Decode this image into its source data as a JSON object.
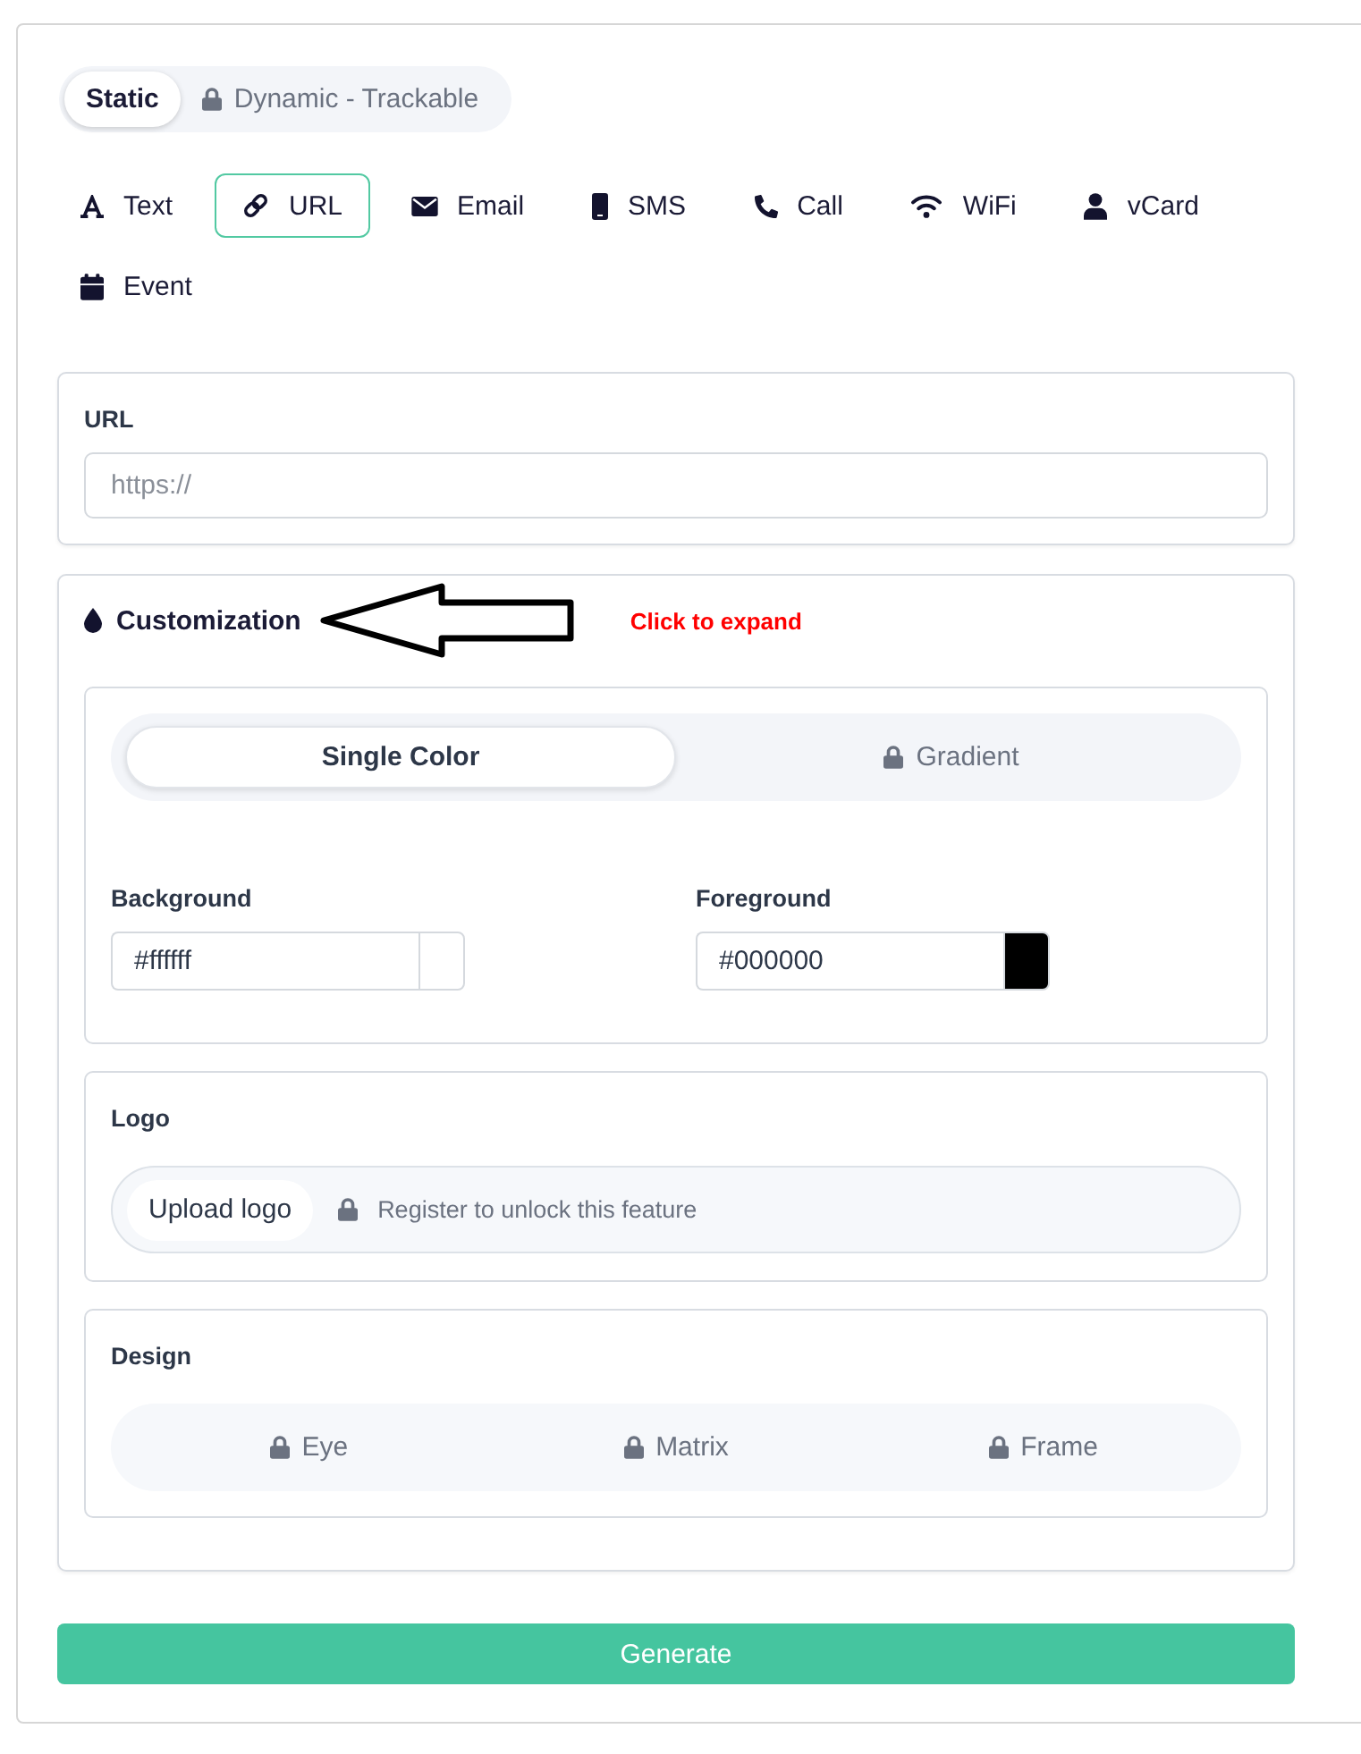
{
  "mode_toggle": [
    {
      "label": "Static",
      "selected": true,
      "locked": false
    },
    {
      "label": "Dynamic - Trackable",
      "selected": false,
      "locked": true
    }
  ],
  "type_tabs": [
    {
      "kind": "text",
      "label": "Text",
      "selected": false
    },
    {
      "kind": "url",
      "label": "URL",
      "selected": true
    },
    {
      "kind": "email",
      "label": "Email",
      "selected": false
    },
    {
      "kind": "sms",
      "label": "SMS",
      "selected": false
    },
    {
      "kind": "call",
      "label": "Call",
      "selected": false
    },
    {
      "kind": "wifi",
      "label": "WiFi",
      "selected": false
    },
    {
      "kind": "vcard",
      "label": "vCard",
      "selected": false
    },
    {
      "kind": "event",
      "label": "Event",
      "selected": false
    }
  ],
  "url_section": {
    "label": "URL",
    "placeholder": "https://"
  },
  "customization": {
    "title": "Customization",
    "annotation": "Click to expand",
    "color_mode": [
      {
        "label": "Single Color",
        "selected": true,
        "locked": false
      },
      {
        "label": "Gradient",
        "selected": false,
        "locked": true
      }
    ],
    "colors": [
      {
        "label": "Background",
        "value": "#ffffff",
        "color": "#ffffff"
      },
      {
        "label": "Foreground",
        "value": "#000000",
        "color": "#000000"
      }
    ],
    "logo": {
      "label": "Logo",
      "button": "Upload logo",
      "note": "Register to unlock this feature",
      "locked": true
    },
    "design": {
      "label": "Design",
      "options": [
        {
          "label": "Eye",
          "locked": true
        },
        {
          "label": "Matrix",
          "locked": true
        },
        {
          "label": "Frame",
          "locked": true
        }
      ]
    }
  },
  "generate_button": "Generate"
}
